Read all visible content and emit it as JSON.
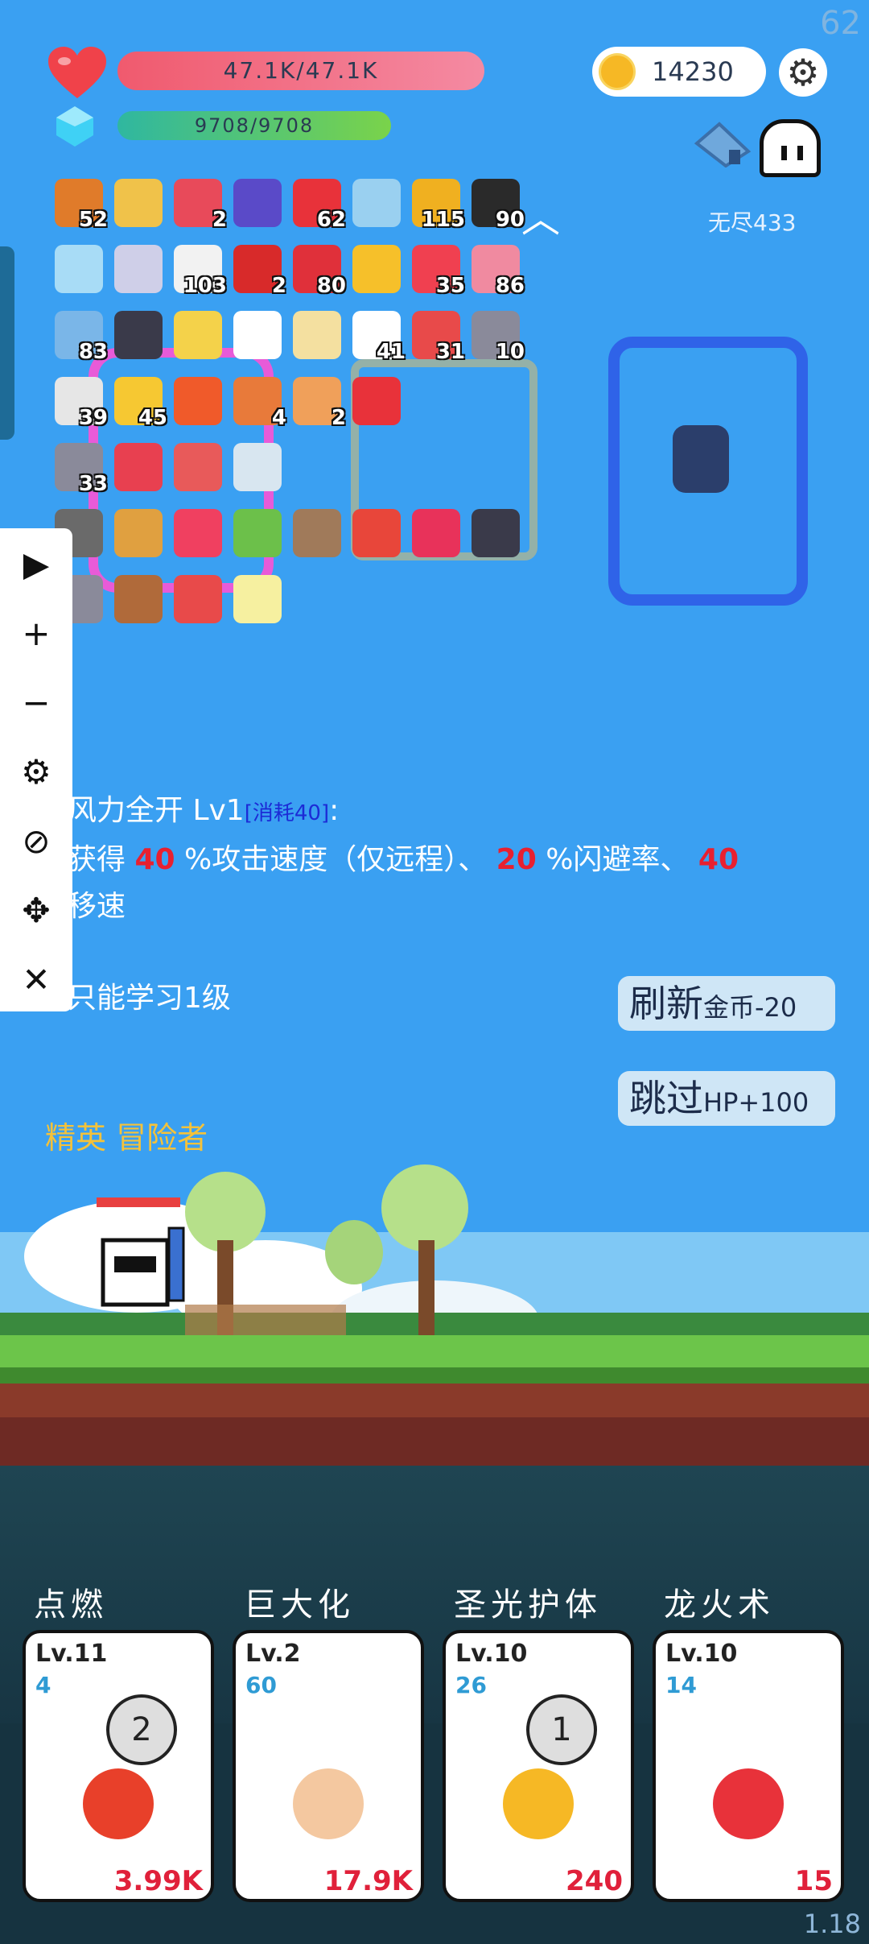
{
  "fps": "62",
  "version": "1.18",
  "hud": {
    "hp_text": "47.1K/47.1K",
    "mp_text": "9708/9708",
    "coins": "14230",
    "mode_label": "无尽433",
    "hp_icon": "heart-icon",
    "mp_icon": "diamond-icon",
    "settings_icon": "gear-icon"
  },
  "inventory": [
    {
      "icon": "book-icon",
      "count": "52"
    },
    {
      "icon": "scroll-icon",
      "count": ""
    },
    {
      "icon": "shield-icon",
      "count": "2"
    },
    {
      "icon": "wizard-hat-icon",
      "count": ""
    },
    {
      "icon": "apple-icon",
      "count": "62"
    },
    {
      "icon": "shirt-icon",
      "count": ""
    },
    {
      "icon": "helmet-icon",
      "count": "115"
    },
    {
      "icon": "battery-icon",
      "count": "90"
    },
    {
      "icon": "ice-block-icon",
      "count": ""
    },
    {
      "icon": "unicorn-icon",
      "count": ""
    },
    {
      "icon": "envelope-icon",
      "count": "103"
    },
    {
      "icon": "magnet-icon",
      "count": "2"
    },
    {
      "icon": "strawberry-icon",
      "count": "80"
    },
    {
      "icon": "sun-icon",
      "count": ""
    },
    {
      "icon": "pill-icon",
      "count": "35"
    },
    {
      "icon": "ice-cream-icon",
      "count": "86"
    },
    {
      "icon": "sword-icon",
      "count": "83"
    },
    {
      "icon": "skull-book-icon",
      "count": ""
    },
    {
      "icon": "magic-wand-icon",
      "count": ""
    },
    {
      "icon": "list-icon",
      "count": ""
    },
    {
      "icon": "treasure-map-icon",
      "count": ""
    },
    {
      "icon": "ghost-icon",
      "count": "41"
    },
    {
      "icon": "sock-icon",
      "count": "31"
    },
    {
      "icon": "mace-icon",
      "count": "10"
    },
    {
      "icon": "cards-icon",
      "count": "39"
    },
    {
      "icon": "cheese-icon",
      "count": "45"
    },
    {
      "icon": "fire-ring-icon",
      "count": ""
    },
    {
      "icon": "briefcase-icon",
      "count": "4"
    },
    {
      "icon": "crown-icon",
      "count": "2"
    },
    {
      "icon": "location-pin-icon",
      "count": ""
    },
    {
      "icon": "tombstone-icon",
      "count": "33"
    },
    {
      "icon": "heart-wings-icon",
      "count": ""
    },
    {
      "icon": "heat-waves-icon",
      "count": ""
    },
    {
      "icon": "cloud-flame-icon",
      "count": ""
    },
    {
      "icon": "mortar-icon",
      "count": ""
    },
    {
      "icon": "bow-icon",
      "count": ""
    },
    {
      "icon": "flame-icon",
      "count": ""
    },
    {
      "icon": "lime-icon",
      "count": ""
    },
    {
      "icon": "meteor-icon",
      "count": ""
    },
    {
      "icon": "gift-icon",
      "count": ""
    },
    {
      "icon": "ruby-icon",
      "count": ""
    },
    {
      "icon": "hooded-figure-icon",
      "count": ""
    },
    {
      "icon": "axe-icon",
      "count": ""
    },
    {
      "icon": "meat-icon",
      "count": ""
    },
    {
      "icon": "potion-icon",
      "count": ""
    },
    {
      "icon": "light-crystal-icon",
      "count": ""
    }
  ],
  "toolbar": [
    "play-icon",
    "plus-icon",
    "minus-icon",
    "gear-icon",
    "eye-off-icon",
    "move-icon",
    "close-icon"
  ],
  "toolbar_glyphs": [
    "▶",
    "+",
    "−",
    "⚙",
    "⊘",
    "✥",
    "✕"
  ],
  "skill_offer": {
    "name": "风力全开 Lv1",
    "cost": "[消耗40]",
    "colon": ":",
    "line1_a": "获得 ",
    "v1": "40",
    "line1_b": " %攻击速度（仅远程）、 ",
    "v2": "20",
    "line1_c": " %闪避率、 ",
    "v3": "40",
    "line2": "移速",
    "limit": "只能学习1级"
  },
  "buttons": {
    "refresh_label": "刷新",
    "refresh_cost": "金币-20",
    "skip_label": "跳过",
    "skip_bonus": "HP+100"
  },
  "enemy_label": "精英 冒险者",
  "skills": [
    {
      "name": "点燃",
      "level": "Lv.11",
      "cooldown": "4",
      "power": "3.99K",
      "icon": "thermometer-icon",
      "reticle": "2"
    },
    {
      "name": "巨大化",
      "level": "Lv.2",
      "cooldown": "60",
      "power": "17.9K",
      "icon": "fist-icon",
      "reticle": ""
    },
    {
      "name": "圣光护体",
      "level": "Lv.10",
      "cooldown": "26",
      "power": "240",
      "icon": "coins-icon",
      "reticle": "1"
    },
    {
      "name": "龙火术",
      "level": "Lv.10",
      "cooldown": "14",
      "power": "15",
      "icon": "watermelon-icon",
      "reticle": ""
    }
  ],
  "colors": {
    "sky": "#3aa0f2",
    "hp": "#f05a6e",
    "mp": "#7ad34a",
    "accent_red": "#e82030",
    "cost_blue": "#1c2bd6",
    "enemy_gold": "#f4c23a"
  }
}
